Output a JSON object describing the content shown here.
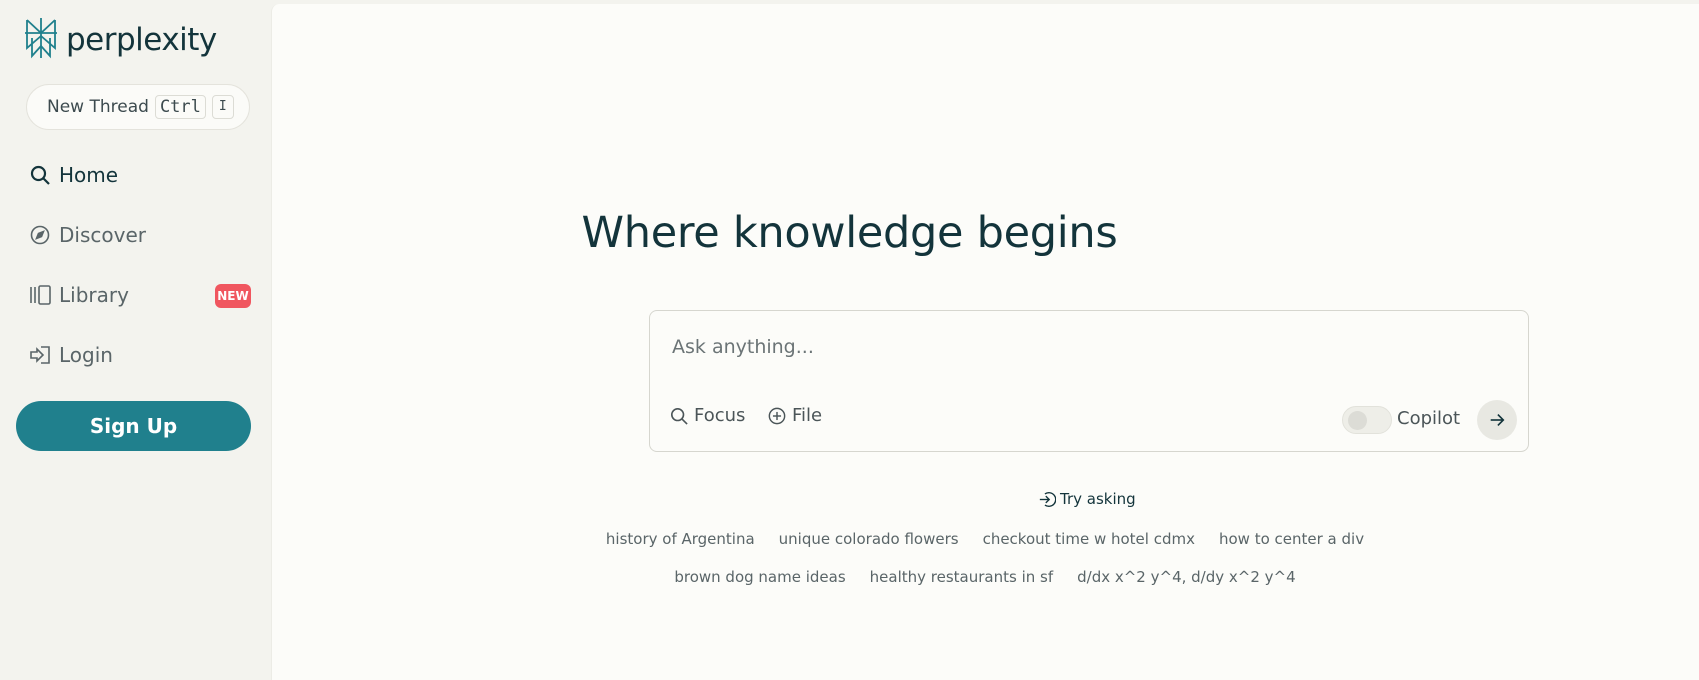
{
  "brand": {
    "name": "perplexity"
  },
  "sidebar": {
    "new_thread": {
      "label": "New Thread",
      "shortcut_mod": "Ctrl",
      "shortcut_key": "I"
    },
    "items": [
      {
        "label": "Home",
        "icon": "search-icon"
      },
      {
        "label": "Discover",
        "icon": "compass-icon"
      },
      {
        "label": "Library",
        "icon": "library-icon",
        "badge": "NEW"
      },
      {
        "label": "Login",
        "icon": "login-icon"
      }
    ],
    "signup_label": "Sign Up"
  },
  "main": {
    "headline": "Where knowledge begins",
    "search": {
      "placeholder": "Ask anything...",
      "focus_label": "Focus",
      "file_label": "File",
      "copilot_label": "Copilot",
      "copilot_enabled": false
    },
    "try_asking_label": "Try asking",
    "suggestions_row1": [
      "history of Argentina",
      "unique colorado flowers",
      "checkout time w hotel cdmx",
      "how to center a div"
    ],
    "suggestions_row2": [
      "brown dog name ideas",
      "healthy restaurants in sf",
      "d/dx x^2 y^4, d/dy x^2 y^4"
    ]
  },
  "colors": {
    "accent": "#20808d",
    "text_primary": "#13343b",
    "badge_red": "#f0565f",
    "background": "#f3f3ee",
    "panel": "#fcfcf9"
  }
}
